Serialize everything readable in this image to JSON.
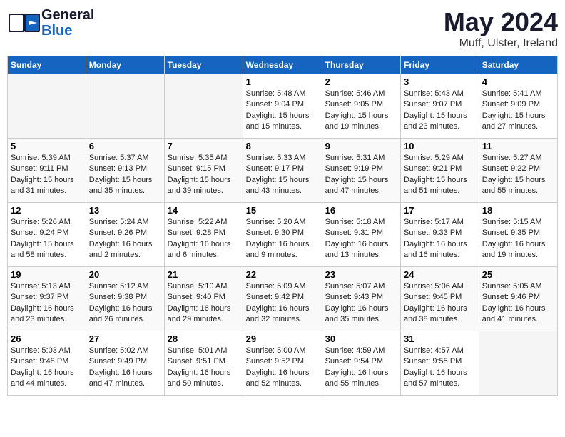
{
  "header": {
    "logo_general": "General",
    "logo_blue": "Blue",
    "month_year": "May 2024",
    "location": "Muff, Ulster, Ireland"
  },
  "days_of_week": [
    "Sunday",
    "Monday",
    "Tuesday",
    "Wednesday",
    "Thursday",
    "Friday",
    "Saturday"
  ],
  "weeks": [
    [
      {
        "day": "",
        "info": ""
      },
      {
        "day": "",
        "info": ""
      },
      {
        "day": "",
        "info": ""
      },
      {
        "day": "1",
        "info": "Sunrise: 5:48 AM\nSunset: 9:04 PM\nDaylight: 15 hours\nand 15 minutes."
      },
      {
        "day": "2",
        "info": "Sunrise: 5:46 AM\nSunset: 9:05 PM\nDaylight: 15 hours\nand 19 minutes."
      },
      {
        "day": "3",
        "info": "Sunrise: 5:43 AM\nSunset: 9:07 PM\nDaylight: 15 hours\nand 23 minutes."
      },
      {
        "day": "4",
        "info": "Sunrise: 5:41 AM\nSunset: 9:09 PM\nDaylight: 15 hours\nand 27 minutes."
      }
    ],
    [
      {
        "day": "5",
        "info": "Sunrise: 5:39 AM\nSunset: 9:11 PM\nDaylight: 15 hours\nand 31 minutes."
      },
      {
        "day": "6",
        "info": "Sunrise: 5:37 AM\nSunset: 9:13 PM\nDaylight: 15 hours\nand 35 minutes."
      },
      {
        "day": "7",
        "info": "Sunrise: 5:35 AM\nSunset: 9:15 PM\nDaylight: 15 hours\nand 39 minutes."
      },
      {
        "day": "8",
        "info": "Sunrise: 5:33 AM\nSunset: 9:17 PM\nDaylight: 15 hours\nand 43 minutes."
      },
      {
        "day": "9",
        "info": "Sunrise: 5:31 AM\nSunset: 9:19 PM\nDaylight: 15 hours\nand 47 minutes."
      },
      {
        "day": "10",
        "info": "Sunrise: 5:29 AM\nSunset: 9:21 PM\nDaylight: 15 hours\nand 51 minutes."
      },
      {
        "day": "11",
        "info": "Sunrise: 5:27 AM\nSunset: 9:22 PM\nDaylight: 15 hours\nand 55 minutes."
      }
    ],
    [
      {
        "day": "12",
        "info": "Sunrise: 5:26 AM\nSunset: 9:24 PM\nDaylight: 15 hours\nand 58 minutes."
      },
      {
        "day": "13",
        "info": "Sunrise: 5:24 AM\nSunset: 9:26 PM\nDaylight: 16 hours\nand 2 minutes."
      },
      {
        "day": "14",
        "info": "Sunrise: 5:22 AM\nSunset: 9:28 PM\nDaylight: 16 hours\nand 6 minutes."
      },
      {
        "day": "15",
        "info": "Sunrise: 5:20 AM\nSunset: 9:30 PM\nDaylight: 16 hours\nand 9 minutes."
      },
      {
        "day": "16",
        "info": "Sunrise: 5:18 AM\nSunset: 9:31 PM\nDaylight: 16 hours\nand 13 minutes."
      },
      {
        "day": "17",
        "info": "Sunrise: 5:17 AM\nSunset: 9:33 PM\nDaylight: 16 hours\nand 16 minutes."
      },
      {
        "day": "18",
        "info": "Sunrise: 5:15 AM\nSunset: 9:35 PM\nDaylight: 16 hours\nand 19 minutes."
      }
    ],
    [
      {
        "day": "19",
        "info": "Sunrise: 5:13 AM\nSunset: 9:37 PM\nDaylight: 16 hours\nand 23 minutes."
      },
      {
        "day": "20",
        "info": "Sunrise: 5:12 AM\nSunset: 9:38 PM\nDaylight: 16 hours\nand 26 minutes."
      },
      {
        "day": "21",
        "info": "Sunrise: 5:10 AM\nSunset: 9:40 PM\nDaylight: 16 hours\nand 29 minutes."
      },
      {
        "day": "22",
        "info": "Sunrise: 5:09 AM\nSunset: 9:42 PM\nDaylight: 16 hours\nand 32 minutes."
      },
      {
        "day": "23",
        "info": "Sunrise: 5:07 AM\nSunset: 9:43 PM\nDaylight: 16 hours\nand 35 minutes."
      },
      {
        "day": "24",
        "info": "Sunrise: 5:06 AM\nSunset: 9:45 PM\nDaylight: 16 hours\nand 38 minutes."
      },
      {
        "day": "25",
        "info": "Sunrise: 5:05 AM\nSunset: 9:46 PM\nDaylight: 16 hours\nand 41 minutes."
      }
    ],
    [
      {
        "day": "26",
        "info": "Sunrise: 5:03 AM\nSunset: 9:48 PM\nDaylight: 16 hours\nand 44 minutes."
      },
      {
        "day": "27",
        "info": "Sunrise: 5:02 AM\nSunset: 9:49 PM\nDaylight: 16 hours\nand 47 minutes."
      },
      {
        "day": "28",
        "info": "Sunrise: 5:01 AM\nSunset: 9:51 PM\nDaylight: 16 hours\nand 50 minutes."
      },
      {
        "day": "29",
        "info": "Sunrise: 5:00 AM\nSunset: 9:52 PM\nDaylight: 16 hours\nand 52 minutes."
      },
      {
        "day": "30",
        "info": "Sunrise: 4:59 AM\nSunset: 9:54 PM\nDaylight: 16 hours\nand 55 minutes."
      },
      {
        "day": "31",
        "info": "Sunrise: 4:57 AM\nSunset: 9:55 PM\nDaylight: 16 hours\nand 57 minutes."
      },
      {
        "day": "",
        "info": ""
      }
    ]
  ]
}
